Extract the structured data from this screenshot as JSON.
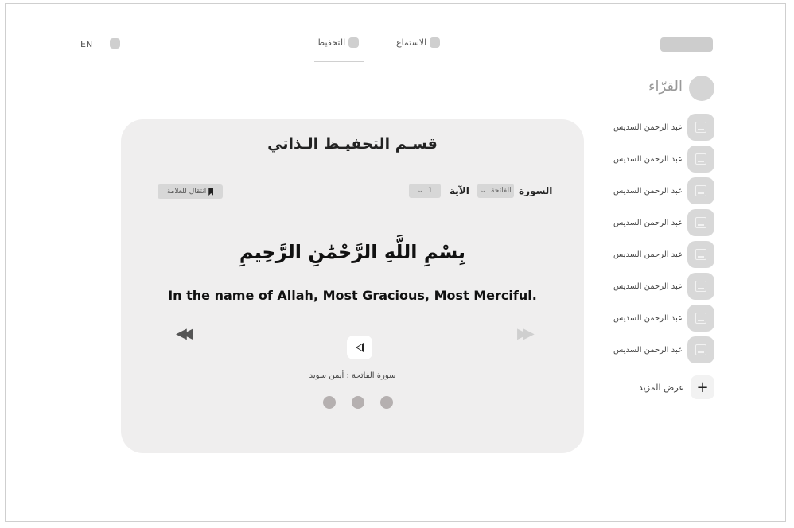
{
  "header": {
    "lang": "EN",
    "tabs": [
      {
        "label": "التحفيظ",
        "active": true
      },
      {
        "label": "الاستماع",
        "active": false
      }
    ]
  },
  "sidebar": {
    "title": "القرّاء",
    "readers": [
      "عبد الرحمن السديس",
      "عبد الرحمن السديس",
      "عبد الرحمن السديس",
      "عبد الرحمن السديس",
      "عبد الرحمن السديس",
      "عبد الرحمن السديس",
      "عبد الرحمن السديس",
      "عبد الرحمن السديس"
    ],
    "more_label": "عرض المزيد",
    "more_icon": "+"
  },
  "card": {
    "title": "قسـم التحفيـظ الـذاتي",
    "bookmark_label": "انتقال للعلامة",
    "surah_label": "السورة",
    "surah_value": "الفاتحة",
    "ayah_label": "الآية",
    "ayah_value": "1",
    "verse_arabic": "بِسْمِ اللَّهِ الرَّحْمَٰنِ الرَّحِيمِ",
    "verse_english": "In the name of Allah, Most Gracious, Most Merciful.",
    "prev_icon": "◀◀",
    "next_icon": "▶▶",
    "caption": "سورة الفاتحة : أيمن سويد",
    "pager_count": 3
  }
}
